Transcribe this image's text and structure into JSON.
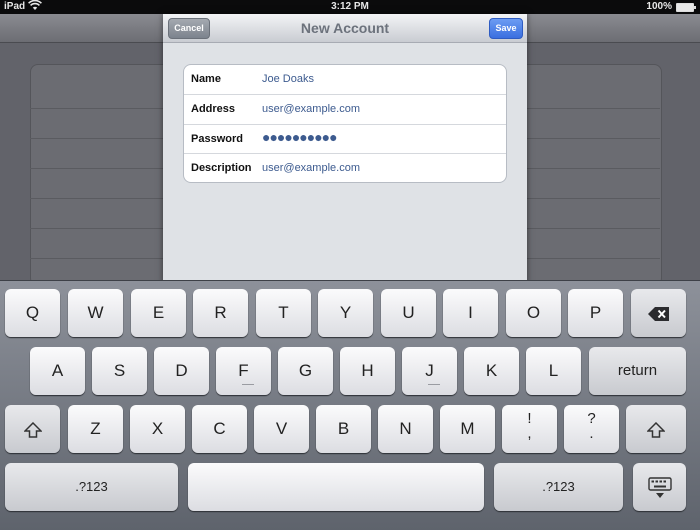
{
  "status_bar": {
    "carrier": "iPad",
    "wifi_icon": "wifi-icon",
    "time": "3:12 PM",
    "battery": "100%"
  },
  "sheet": {
    "title": "New Account",
    "cancel_label": "Cancel",
    "save_label": "Save",
    "fields": [
      {
        "label": "Name",
        "value": "Joe Doaks"
      },
      {
        "label": "Address",
        "value": "user@example.com"
      },
      {
        "label": "Password",
        "value": "●●●●●●●●●●"
      },
      {
        "label": "Description",
        "value": "user@example.com"
      }
    ]
  },
  "keyboard": {
    "row1": [
      "Q",
      "W",
      "E",
      "R",
      "T",
      "Y",
      "U",
      "I",
      "O",
      "P"
    ],
    "backspace_icon": "backspace-icon",
    "row2": [
      "A",
      "S",
      "D",
      "F",
      "G",
      "H",
      "J",
      "K",
      "L"
    ],
    "return_label": "return",
    "shift_icon": "shift-icon",
    "row3": [
      "Z",
      "X",
      "C",
      "V",
      "B",
      "N",
      "M"
    ],
    "punct": [
      {
        "top": "!",
        "bottom": ","
      },
      {
        "top": "?",
        "bottom": "."
      }
    ],
    "numbers_label": ".?123",
    "hide_keyboard_icon": "keyboard-hide-icon"
  }
}
